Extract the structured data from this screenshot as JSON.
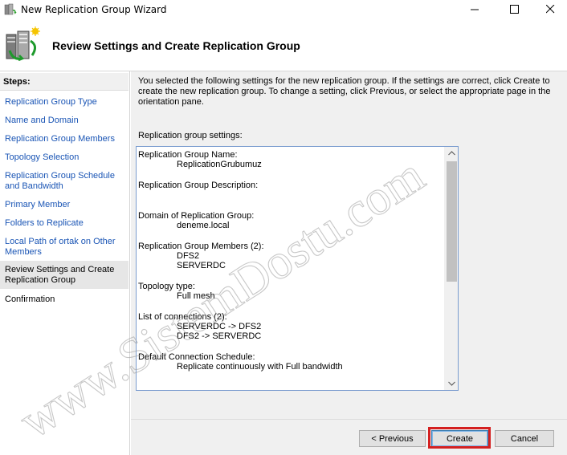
{
  "window": {
    "title": "New Replication Group Wizard",
    "icon": "replication-app-icon"
  },
  "header": {
    "title": "Review Settings and Create Replication Group",
    "icon": "replication-server-icon"
  },
  "steps": {
    "heading": "Steps:",
    "items": [
      {
        "label": "Replication Group Type",
        "state": "link"
      },
      {
        "label": "Name and Domain",
        "state": "link"
      },
      {
        "label": "Replication Group Members",
        "state": "link"
      },
      {
        "label": "Topology Selection",
        "state": "link"
      },
      {
        "label": "Replication Group Schedule and Bandwidth",
        "state": "link"
      },
      {
        "label": "Primary Member",
        "state": "link"
      },
      {
        "label": "Folders to Replicate",
        "state": "link"
      },
      {
        "label": "Local Path of ortak on Other Members",
        "state": "link"
      },
      {
        "label": "Review Settings and Create Replication Group",
        "state": "current"
      },
      {
        "label": "Confirmation",
        "state": "disabled"
      }
    ]
  },
  "main": {
    "intro": "You selected the following settings for the new replication group. If the settings are correct, click Create to create the new replication group. To change a setting, click Previous, or select the appropriate page in the orientation pane.",
    "settings_label": "Replication group settings:",
    "settings": [
      {
        "heading": "Replication Group Name:",
        "values": [
          "ReplicationGrubumuz"
        ]
      },
      {
        "heading": "Replication Group Description:",
        "values": [
          ""
        ]
      },
      {
        "heading": "Domain of Replication Group:",
        "values": [
          "deneme.local"
        ]
      },
      {
        "heading": "Replication Group Members (2):",
        "values": [
          "DFS2",
          "SERVERDC"
        ]
      },
      {
        "heading": "Topology type:",
        "values": [
          "Full mesh"
        ]
      },
      {
        "heading": "List of connections (2):",
        "values": [
          "SERVERDC -> DFS2",
          "DFS2 -> SERVERDC"
        ]
      },
      {
        "heading": "Default Connection Schedule:",
        "values": [
          "Replicate continuously with Full bandwidth"
        ]
      }
    ]
  },
  "buttons": {
    "previous": "< Previous",
    "create": "Create",
    "cancel": "Cancel"
  },
  "watermark": {
    "text": "www.SistemDostu.com"
  },
  "colors": {
    "link": "#1a55b5",
    "highlight": "#d42020",
    "box_border": "#7a9ccf"
  }
}
